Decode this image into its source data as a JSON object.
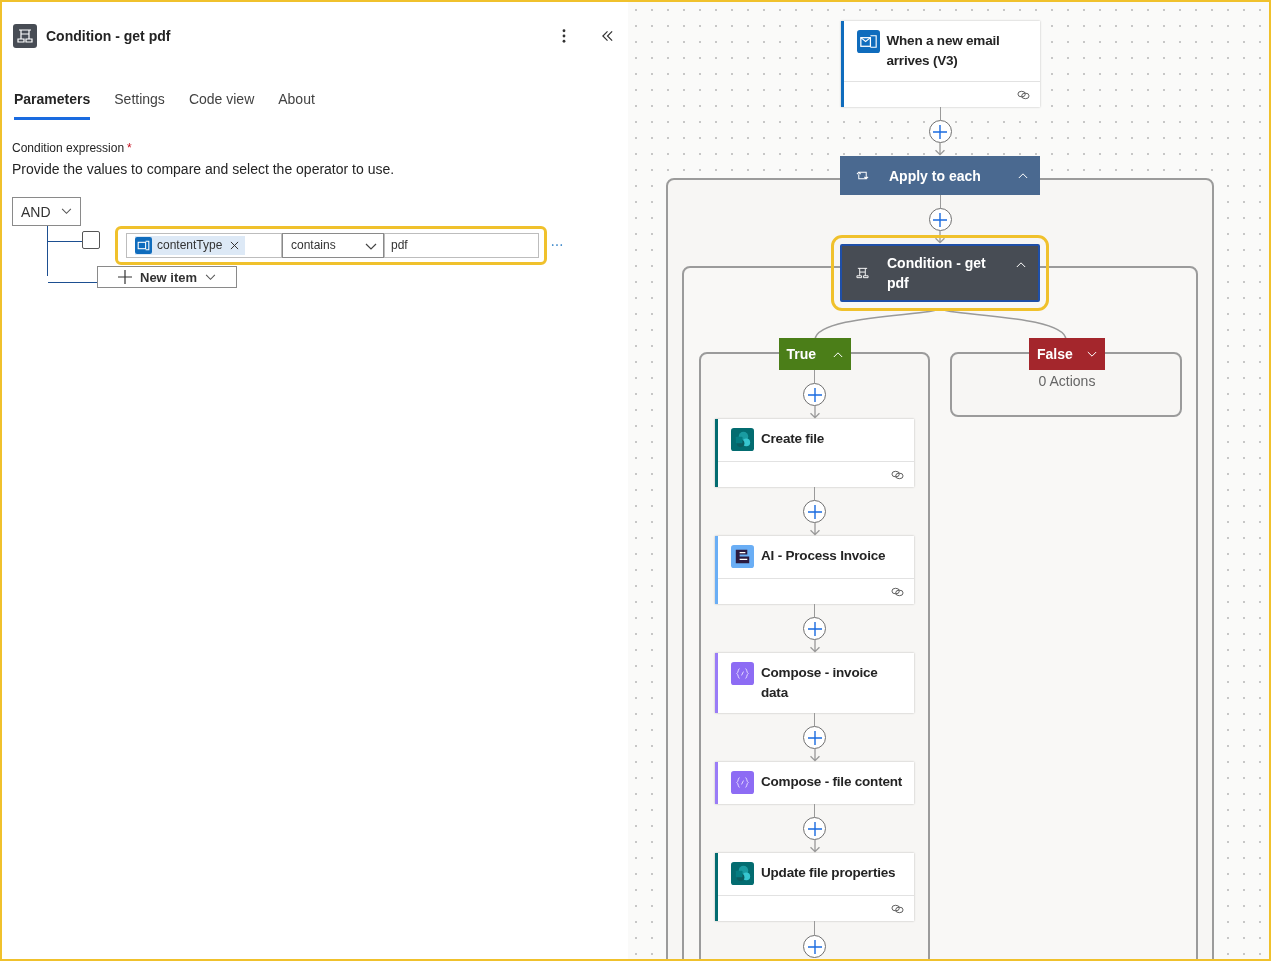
{
  "panel": {
    "title": "Condition - get pdf",
    "tabs": [
      {
        "label": "Parameters",
        "selected": true
      },
      {
        "label": "Settings",
        "selected": false
      },
      {
        "label": "Code view",
        "selected": false
      },
      {
        "label": "About",
        "selected": false
      }
    ],
    "field_label": "Condition expression",
    "required_mark": "*",
    "description": "Provide the values to compare and select the operator to use.",
    "group_operator": "AND",
    "rows": [
      {
        "checked": false,
        "token": "contentType",
        "operator": "contains",
        "value": "pdf",
        "highlighted": true
      }
    ],
    "new_item": "New item"
  },
  "flow": {
    "trigger": {
      "title": "When a new email arrives (V3)",
      "kind": "outlook",
      "linked": true
    },
    "loop": {
      "title": "Apply to each",
      "expanded": true
    },
    "condition": {
      "title": "Condition - get pdf",
      "expanded": true,
      "selected": true
    },
    "true_branch": {
      "label": "True",
      "expanded": true,
      "actions": [
        {
          "title": "Create file",
          "kind": "sharepoint",
          "linked": true
        },
        {
          "title": "AI - Process Invoice",
          "kind": "ai",
          "linked": true
        },
        {
          "title": "Compose - invoice data",
          "kind": "compose",
          "linked": false
        },
        {
          "title": "Compose - file content",
          "kind": "compose",
          "linked": false
        },
        {
          "title": "Update file properties",
          "kind": "sharepoint",
          "linked": true
        }
      ]
    },
    "false_branch": {
      "label": "False",
      "expanded": false,
      "empty_text": "0 Actions"
    }
  }
}
